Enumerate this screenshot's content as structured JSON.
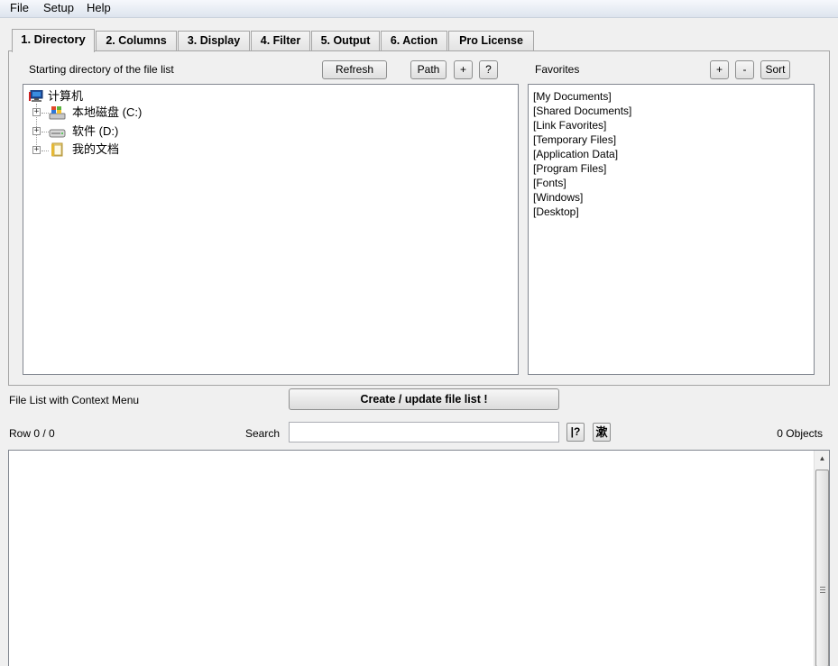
{
  "menu": [
    "File",
    "Setup",
    "Help"
  ],
  "tabs": [
    "1. Directory",
    "2. Columns",
    "3. Display",
    "4. Filter",
    "5. Output",
    "6. Action",
    "Pro License"
  ],
  "directory": {
    "label": "Starting directory of the file list",
    "refresh_label": "Refresh",
    "path_label": "Path",
    "plus_label": "+",
    "help_label": "?",
    "tree": {
      "root": "计算机",
      "children": [
        "本地磁盘 (C:)",
        "软件 (D:)",
        "我的文档"
      ],
      "expander": "+"
    }
  },
  "favorites": {
    "label": "Favorites",
    "add_label": "+",
    "remove_label": "-",
    "sort_label": "Sort",
    "items": [
      "[My Documents]",
      "[Shared Documents]",
      "[Link Favorites]",
      "[Temporary Files]",
      "[Application Data]",
      "[Program Files]",
      "[Fonts]",
      "[Windows]",
      "[Desktop]"
    ]
  },
  "file_list": {
    "label": "File List with Context Menu",
    "create_label": "Create / update file list !",
    "row_status": "Row 0 / 0",
    "search_label": "Search",
    "search_value": "",
    "regex_label": "|?",
    "cjk_label": "漱",
    "objects_count": "0 Objects"
  },
  "icons": {
    "computer": "computer-icon",
    "drive_c": "windows-drive-icon",
    "drive_d": "hard-drive-icon",
    "documents": "documents-folder-icon",
    "scroll_up": "▲"
  },
  "colors": {
    "background": "#f0f0f0",
    "border": "#828790"
  }
}
